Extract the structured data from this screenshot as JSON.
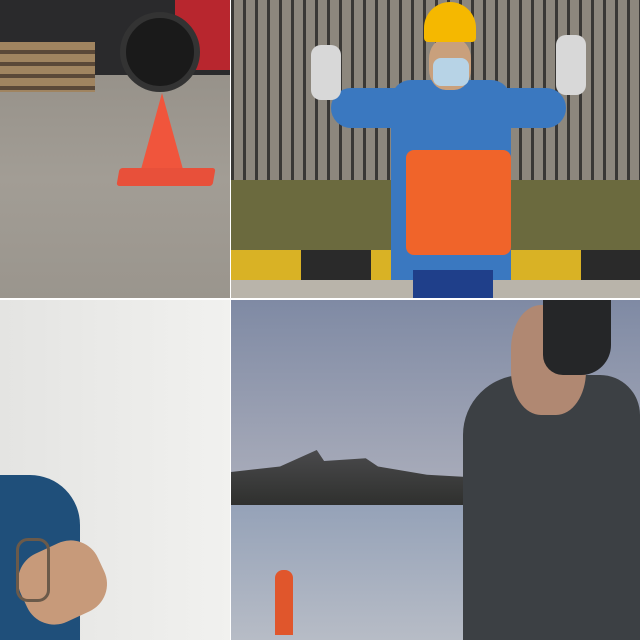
{
  "colors": {
    "cone": "#f0553c",
    "hard_hat": "#f5b800",
    "safety_vest": "#f0642a",
    "worker_shirt": "#3a78c0",
    "sky": "#8a93aa",
    "jacket": "#3c4044",
    "polo_shirt": "#1f4f7a"
  }
}
